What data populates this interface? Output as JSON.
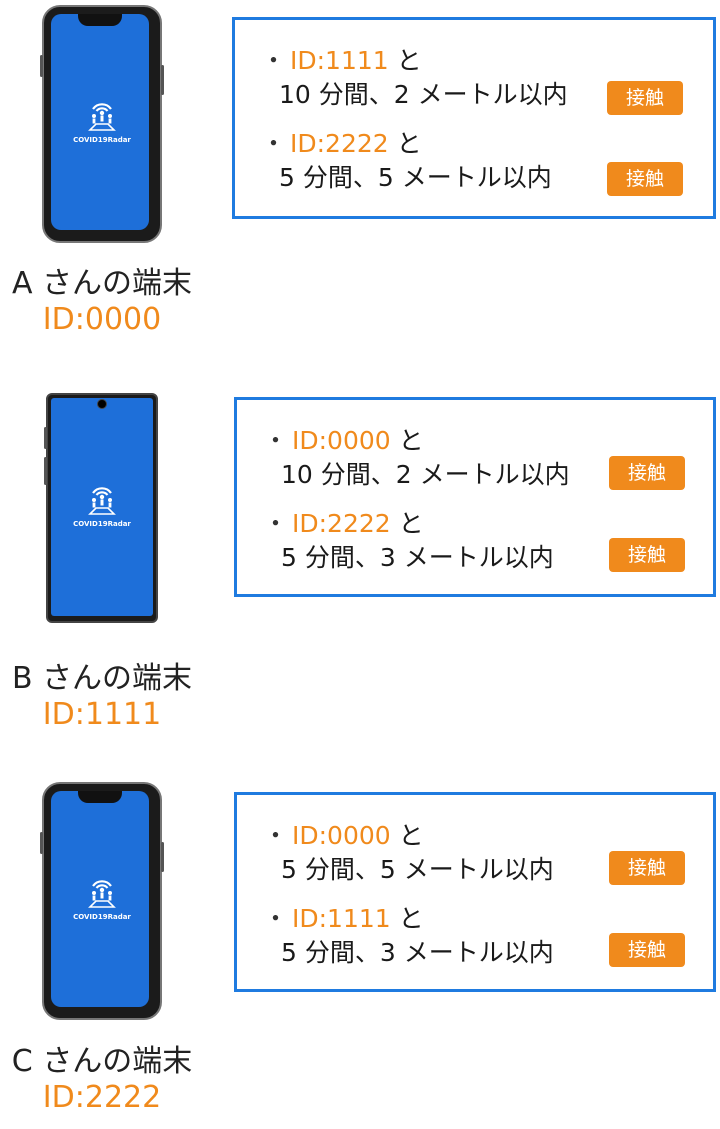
{
  "app_name": "COVID19Radar",
  "colors": {
    "accent_orange": "#f08a1c",
    "box_blue": "#1f7be0",
    "screen_blue": "#1e6fd9"
  },
  "devices": [
    {
      "name": "A さんの端末",
      "id": "ID:0000",
      "contacts": [
        {
          "id": "ID:1111",
          "suffix": " と",
          "detail": "10 分間、2 メートル以内",
          "badge": "接触"
        },
        {
          "id": "ID:2222",
          "suffix": " と",
          "detail": "5 分間、5 メートル以内",
          "badge": "接触"
        }
      ]
    },
    {
      "name": "B さんの端末",
      "id": "ID:1111",
      "contacts": [
        {
          "id": "ID:0000",
          "suffix": " と",
          "detail": "10 分間、2 メートル以内",
          "badge": "接触"
        },
        {
          "id": "ID:2222",
          "suffix": " と",
          "detail": "5 分間、3 メートル以内",
          "badge": "接触"
        }
      ]
    },
    {
      "name": "C さんの端末",
      "id": "ID:2222",
      "contacts": [
        {
          "id": "ID:0000",
          "suffix": " と",
          "detail": "5 分間、5 メートル以内",
          "badge": "接触"
        },
        {
          "id": "ID:1111",
          "suffix": " と",
          "detail": "5 分間、3 メートル以内",
          "badge": "接触"
        }
      ]
    }
  ]
}
